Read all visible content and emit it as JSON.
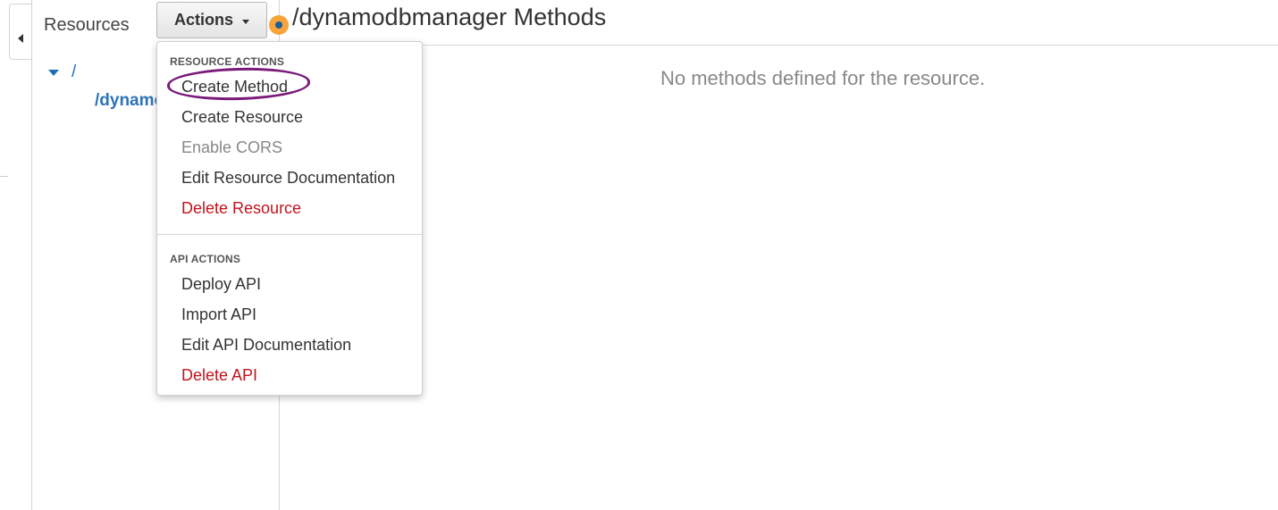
{
  "sidebar": {
    "title": "Resources",
    "tree": {
      "root": "/",
      "child": "/dynamodbmanager"
    }
  },
  "actions_button": {
    "label": "Actions"
  },
  "main": {
    "title": "/dynamodbmanager Methods",
    "empty_message": "No methods defined for the resource."
  },
  "dropdown": {
    "resource_header": "RESOURCE ACTIONS",
    "resource_items": [
      {
        "label": "Create Method",
        "state": "highlighted"
      },
      {
        "label": "Create Resource",
        "state": "normal"
      },
      {
        "label": "Enable CORS",
        "state": "disabled"
      },
      {
        "label": "Edit Resource Documentation",
        "state": "normal"
      },
      {
        "label": "Delete Resource",
        "state": "danger"
      }
    ],
    "api_header": "API ACTIONS",
    "api_items": [
      {
        "label": "Deploy API",
        "state": "normal"
      },
      {
        "label": "Import API",
        "state": "normal"
      },
      {
        "label": "Edit API Documentation",
        "state": "normal"
      },
      {
        "label": "Delete API",
        "state": "danger"
      }
    ]
  },
  "colors": {
    "link_blue": "#1e6fb8",
    "danger_red": "#c0141c",
    "annotation_purple": "#7a1a7a",
    "indicator_orange": "#f7a43a"
  },
  "icons": {
    "collapse": "caret-left-icon",
    "tree_toggle": "caret-down-icon",
    "status": "status-dot-icon"
  }
}
